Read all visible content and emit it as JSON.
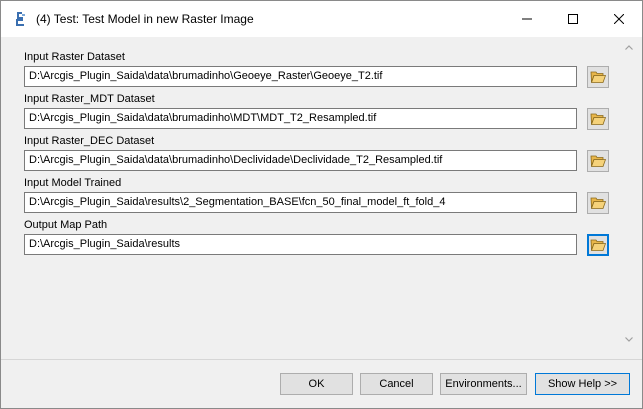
{
  "window": {
    "title": "(4) Test: Test Model in new Raster Image"
  },
  "fields": [
    {
      "label": "Input Raster Dataset",
      "value": "D:\\Arcgis_Plugin_Saida\\data\\brumadinho\\Geoeye_Raster\\Geoeye_T2.tif"
    },
    {
      "label": "Input Raster_MDT Dataset",
      "value": "D:\\Arcgis_Plugin_Saida\\data\\brumadinho\\MDT\\MDT_T2_Resampled.tif"
    },
    {
      "label": "Input Raster_DEC Dataset",
      "value": "D:\\Arcgis_Plugin_Saida\\data\\brumadinho\\Declividade\\Declividade_T2_Resampled.tif"
    },
    {
      "label": "Input Model Trained",
      "value": "D:\\Arcgis_Plugin_Saida\\results\\2_Segmentation_BASE\\fcn_50_final_model_ft_fold_4"
    },
    {
      "label": "Output Map Path",
      "value": "D:\\Arcgis_Plugin_Saida\\results"
    }
  ],
  "buttons": {
    "ok": "OK",
    "cancel": "Cancel",
    "environments": "Environments...",
    "show_help": "Show Help >>"
  },
  "icons": {
    "app": "arcgis-tool-icon",
    "browse": "folder-open-icon"
  }
}
